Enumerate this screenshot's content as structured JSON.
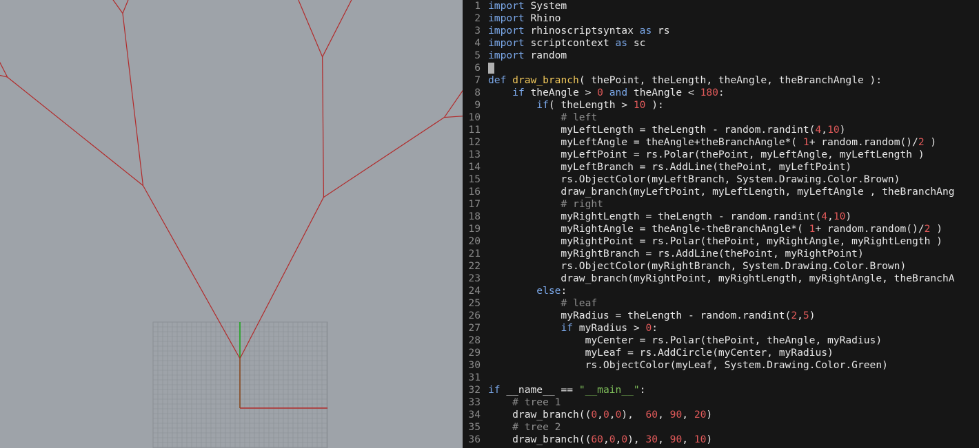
{
  "colors": {
    "viewport_bg": "#9ea3a9",
    "branch": "#b22a2a",
    "leaf": "#1f8f1f",
    "grid": "#8a8f95",
    "axis_x": "#b22a2a",
    "axis_y": "#1aa31a",
    "editor_bg": "#161616",
    "keyword": "#7aa7e8",
    "function": "#f0c75a",
    "number": "#e25a5a",
    "string": "#7fbf5a",
    "comment": "#8f8f8f"
  },
  "code": [
    {
      "n": "1",
      "t": [
        [
          "kw",
          "import"
        ],
        [
          "op",
          " System"
        ]
      ]
    },
    {
      "n": "2",
      "t": [
        [
          "kw",
          "import"
        ],
        [
          "op",
          " Rhino"
        ]
      ]
    },
    {
      "n": "3",
      "t": [
        [
          "kw",
          "import"
        ],
        [
          "op",
          " rhinoscriptsyntax "
        ],
        [
          "kw",
          "as"
        ],
        [
          "op",
          " rs"
        ]
      ]
    },
    {
      "n": "4",
      "t": [
        [
          "kw",
          "import"
        ],
        [
          "op",
          " scriptcontext "
        ],
        [
          "kw",
          "as"
        ],
        [
          "op",
          " sc"
        ]
      ]
    },
    {
      "n": "5",
      "t": [
        [
          "kw",
          "import"
        ],
        [
          "op",
          " random"
        ]
      ]
    },
    {
      "n": "6",
      "t": [],
      "cursor": true
    },
    {
      "n": "7",
      "t": [
        [
          "kw",
          "def"
        ],
        [
          "op",
          " "
        ],
        [
          "fn",
          "draw_branch"
        ],
        [
          "op",
          "( thePoint, theLength, theAngle, theBranchAngle ):"
        ]
      ]
    },
    {
      "n": "8",
      "t": [
        [
          "op",
          "    "
        ],
        [
          "kw",
          "if"
        ],
        [
          "op",
          " theAngle > "
        ],
        [
          "num",
          "0"
        ],
        [
          "op",
          " "
        ],
        [
          "kw",
          "and"
        ],
        [
          "op",
          " theAngle < "
        ],
        [
          "num",
          "180"
        ],
        [
          "op",
          ":"
        ]
      ]
    },
    {
      "n": "9",
      "t": [
        [
          "op",
          "        "
        ],
        [
          "kw",
          "if"
        ],
        [
          "op",
          "( theLength > "
        ],
        [
          "num",
          "10"
        ],
        [
          "op",
          " ):"
        ]
      ]
    },
    {
      "n": "10",
      "t": [
        [
          "op",
          "            "
        ],
        [
          "cm",
          "# left"
        ]
      ]
    },
    {
      "n": "11",
      "t": [
        [
          "op",
          "            myLeftLength = theLength - random.randint("
        ],
        [
          "num",
          "4"
        ],
        [
          "op",
          ","
        ],
        [
          "num",
          "10"
        ],
        [
          "op",
          ")"
        ]
      ]
    },
    {
      "n": "12",
      "t": [
        [
          "op",
          "            myLeftAngle = theAngle+theBranchAngle*( "
        ],
        [
          "num",
          "1"
        ],
        [
          "op",
          "+ random.random()/"
        ],
        [
          "num",
          "2"
        ],
        [
          "op",
          " )"
        ]
      ]
    },
    {
      "n": "13",
      "t": [
        [
          "op",
          "            myLeftPoint = rs.Polar(thePoint, myLeftAngle, myLeftLength )"
        ]
      ]
    },
    {
      "n": "14",
      "t": [
        [
          "op",
          "            myLeftBranch = rs.AddLine(thePoint, myLeftPoint)"
        ]
      ]
    },
    {
      "n": "15",
      "t": [
        [
          "op",
          "            rs.ObjectColor(myLeftBranch, System.Drawing.Color.Brown)"
        ]
      ]
    },
    {
      "n": "16",
      "t": [
        [
          "op",
          "            draw_branch(myLeftPoint, myLeftLength, myLeftAngle , theBranchAng"
        ]
      ]
    },
    {
      "n": "17",
      "t": [
        [
          "op",
          "            "
        ],
        [
          "cm",
          "# right"
        ]
      ]
    },
    {
      "n": "18",
      "t": [
        [
          "op",
          "            myRightLength = theLength - random.randint("
        ],
        [
          "num",
          "4"
        ],
        [
          "op",
          ","
        ],
        [
          "num",
          "10"
        ],
        [
          "op",
          ")"
        ]
      ]
    },
    {
      "n": "19",
      "t": [
        [
          "op",
          "            myRightAngle = theAngle-theBranchAngle*( "
        ],
        [
          "num",
          "1"
        ],
        [
          "op",
          "+ random.random()/"
        ],
        [
          "num",
          "2"
        ],
        [
          "op",
          " )"
        ]
      ]
    },
    {
      "n": "20",
      "t": [
        [
          "op",
          "            myRightPoint = rs.Polar(thePoint, myRightAngle, myRightLength )"
        ]
      ]
    },
    {
      "n": "21",
      "t": [
        [
          "op",
          "            myRightBranch = rs.AddLine(thePoint, myRightPoint)"
        ]
      ]
    },
    {
      "n": "22",
      "t": [
        [
          "op",
          "            rs.ObjectColor(myRightBranch, System.Drawing.Color.Brown)"
        ]
      ]
    },
    {
      "n": "23",
      "t": [
        [
          "op",
          "            draw_branch(myRightPoint, myRightLength, myRightAngle, theBranchA"
        ]
      ]
    },
    {
      "n": "24",
      "t": [
        [
          "op",
          "        "
        ],
        [
          "kw",
          "else"
        ],
        [
          "op",
          ":"
        ]
      ]
    },
    {
      "n": "25",
      "t": [
        [
          "op",
          "            "
        ],
        [
          "cm",
          "# leaf"
        ]
      ]
    },
    {
      "n": "26",
      "t": [
        [
          "op",
          "            myRadius = theLength - random.randint("
        ],
        [
          "num",
          "2"
        ],
        [
          "op",
          ","
        ],
        [
          "num",
          "5"
        ],
        [
          "op",
          ")"
        ]
      ]
    },
    {
      "n": "27",
      "t": [
        [
          "op",
          "            "
        ],
        [
          "kw",
          "if"
        ],
        [
          "op",
          " myRadius > "
        ],
        [
          "num",
          "0"
        ],
        [
          "op",
          ":"
        ]
      ]
    },
    {
      "n": "28",
      "t": [
        [
          "op",
          "                myCenter = rs.Polar(thePoint, theAngle, myRadius)"
        ]
      ]
    },
    {
      "n": "29",
      "t": [
        [
          "op",
          "                myLeaf = rs.AddCircle(myCenter, myRadius)"
        ]
      ]
    },
    {
      "n": "30",
      "t": [
        [
          "op",
          "                rs.ObjectColor(myLeaf, System.Drawing.Color.Green)"
        ]
      ]
    },
    {
      "n": "31",
      "t": []
    },
    {
      "n": "32",
      "t": [
        [
          "kw",
          "if"
        ],
        [
          "op",
          " __name__ == "
        ],
        [
          "str",
          "\"__main__\""
        ],
        [
          "op",
          ":"
        ]
      ]
    },
    {
      "n": "33",
      "t": [
        [
          "op",
          "    "
        ],
        [
          "cm",
          "# tree 1"
        ]
      ]
    },
    {
      "n": "34",
      "t": [
        [
          "op",
          "    draw_branch(("
        ],
        [
          "num",
          "0"
        ],
        [
          "op",
          ","
        ],
        [
          "num",
          "0"
        ],
        [
          "op",
          ","
        ],
        [
          "num",
          "0"
        ],
        [
          "op",
          "),  "
        ],
        [
          "num",
          "60"
        ],
        [
          "op",
          ", "
        ],
        [
          "num",
          "90"
        ],
        [
          "op",
          ", "
        ],
        [
          "num",
          "20"
        ],
        [
          "op",
          ")"
        ]
      ]
    },
    {
      "n": "35",
      "t": [
        [
          "op",
          "    "
        ],
        [
          "cm",
          "# tree 2"
        ]
      ]
    },
    {
      "n": "36",
      "t": [
        [
          "op",
          "    draw_branch(("
        ],
        [
          "num",
          "60"
        ],
        [
          "op",
          ","
        ],
        [
          "num",
          "0"
        ],
        [
          "op",
          ","
        ],
        [
          "num",
          "0"
        ],
        [
          "op",
          "), "
        ],
        [
          "num",
          "30"
        ],
        [
          "op",
          ", "
        ],
        [
          "num",
          "90"
        ],
        [
          "op",
          ", "
        ],
        [
          "num",
          "10"
        ],
        [
          "op",
          ")"
        ]
      ]
    }
  ]
}
